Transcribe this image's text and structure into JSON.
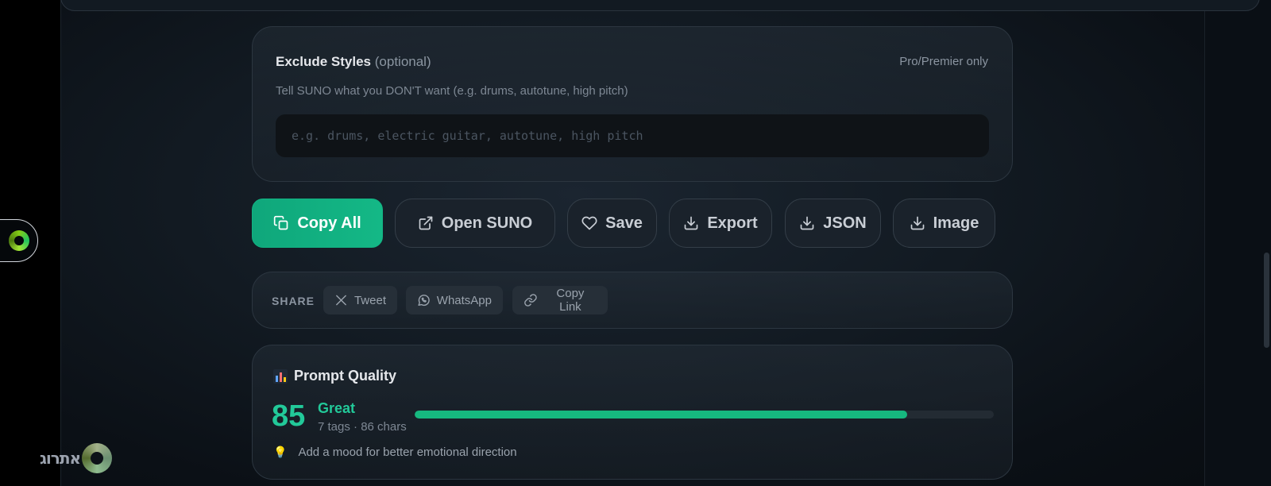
{
  "side": {
    "logo_icon": "ring-logo-icon"
  },
  "brand": {
    "text": "אתרוג"
  },
  "exclude": {
    "title": "Exclude Styles",
    "optional": "(optional)",
    "pro_note": "Pro/Premier only",
    "description": "Tell SUNO what you DON'T want (e.g. drums, autotune, high pitch)",
    "input_value": "",
    "input_placeholder": "e.g. drums, electric guitar, autotune, high pitch"
  },
  "actions": {
    "copy_all": "Copy All",
    "open_suno": "Open SUNO",
    "save": "Save",
    "export": "Export",
    "json": "JSON",
    "image": "Image",
    "accent_color": "#10b981"
  },
  "share": {
    "label": "SHARE",
    "tweet": "Tweet",
    "whatsapp": "WhatsApp",
    "copy_link": "Copy Link"
  },
  "quality": {
    "title": "Prompt Quality",
    "score": "85",
    "grade": "Great",
    "meta": "7 tags · 86 chars",
    "progress_percent": 85,
    "tip": "Add a mood for better emotional direction",
    "score_color": "#22c999"
  }
}
